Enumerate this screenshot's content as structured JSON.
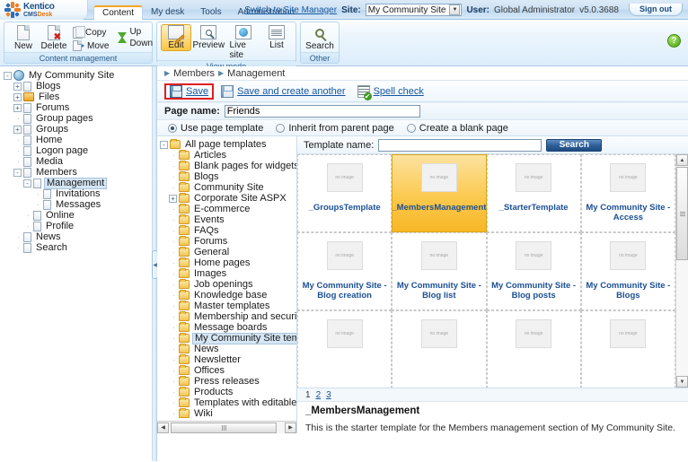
{
  "header": {
    "logo": {
      "brand": "Kentico",
      "cms": "CMS",
      "desk": "Desk"
    },
    "tabs": [
      {
        "label": "Content",
        "active": true
      },
      {
        "label": "My desk",
        "active": false
      },
      {
        "label": "Tools",
        "active": false
      },
      {
        "label": "Administration",
        "active": false
      }
    ],
    "switch_link": "Switch to Site Manager",
    "site_label": "Site:",
    "site_value": "My Community Site",
    "user_label": "User:",
    "user_value": "Global Administrator",
    "version": "v5.0.3688",
    "signout_label": "Sign out",
    "help_icon": "help-icon",
    "accent_orange": "#f5a623",
    "accent_blue": "#1d5b9e"
  },
  "ribbon": {
    "groups": [
      {
        "caption": "Content management",
        "big": [
          {
            "label": "New",
            "icon": "new-page-icon"
          },
          {
            "label": "Delete",
            "icon": "delete-page-icon"
          }
        ],
        "small": [
          {
            "label": "Copy",
            "icon": "copy-icon"
          },
          {
            "label": "Move",
            "icon": "move-icon"
          }
        ],
        "small2": [
          {
            "label": "Up",
            "icon": "arrow-up-icon"
          },
          {
            "label": "Down",
            "icon": "arrow-down-icon"
          }
        ]
      },
      {
        "caption": "View mode",
        "big": [
          {
            "label": "Edit",
            "icon": "edit-icon",
            "selected": true
          },
          {
            "label": "Preview",
            "icon": "preview-icon",
            "selected": false
          },
          {
            "label": "Live site",
            "icon": "live-site-icon",
            "selected": false
          },
          {
            "label": "List",
            "icon": "list-icon",
            "selected": false
          }
        ]
      },
      {
        "caption": "Other",
        "big": [
          {
            "label": "Search",
            "icon": "search-icon"
          }
        ]
      }
    ]
  },
  "content_tree": {
    "nodes": [
      {
        "label": "My Community Site",
        "depth": 0,
        "expander": "-",
        "icon": "globe-icon",
        "selected": false
      },
      {
        "label": "Blogs",
        "depth": 1,
        "expander": "+",
        "icon": "page-icon",
        "selected": false
      },
      {
        "label": "Files",
        "depth": 1,
        "expander": "+",
        "icon": "folder-gold-icon",
        "selected": false
      },
      {
        "label": "Forums",
        "depth": 1,
        "expander": "+",
        "icon": "page-icon",
        "selected": false
      },
      {
        "label": "Group pages",
        "depth": 1,
        "expander": "",
        "icon": "page-icon",
        "selected": false
      },
      {
        "label": "Groups",
        "depth": 1,
        "expander": "+",
        "icon": "page-icon",
        "selected": false
      },
      {
        "label": "Home",
        "depth": 1,
        "expander": "",
        "icon": "page-icon",
        "selected": false
      },
      {
        "label": "Logon page",
        "depth": 1,
        "expander": "",
        "icon": "page-icon",
        "selected": false
      },
      {
        "label": "Media",
        "depth": 1,
        "expander": "",
        "icon": "page-icon",
        "selected": false
      },
      {
        "label": "Members",
        "depth": 1,
        "expander": "-",
        "icon": "page-icon",
        "selected": false
      },
      {
        "label": "Management",
        "depth": 2,
        "expander": "-",
        "icon": "page-icon",
        "selected": true
      },
      {
        "label": "Invitations",
        "depth": 3,
        "expander": "",
        "icon": "page-icon",
        "selected": false
      },
      {
        "label": "Messages",
        "depth": 3,
        "expander": "",
        "icon": "page-icon",
        "selected": false
      },
      {
        "label": "Online",
        "depth": 2,
        "expander": "",
        "icon": "page-icon",
        "selected": false
      },
      {
        "label": "Profile",
        "depth": 2,
        "expander": "",
        "icon": "page-icon",
        "selected": false
      },
      {
        "label": "News",
        "depth": 1,
        "expander": "",
        "icon": "page-icon",
        "selected": false
      },
      {
        "label": "Search",
        "depth": 1,
        "expander": "",
        "icon": "page-icon",
        "selected": false
      }
    ]
  },
  "breadcrumb": {
    "items": [
      "Members",
      "Management"
    ]
  },
  "toolbar": {
    "save_label": "Save",
    "save_create_label": "Save and create another",
    "spell_check_label": "Spell check",
    "highlight_color": "#e02020"
  },
  "form": {
    "page_name_label": "Page name:",
    "page_name_value": "Friends",
    "page_name_placeholder": "",
    "options": [
      {
        "label": "Use page template",
        "selected": true
      },
      {
        "label": "Inherit from parent page",
        "selected": false
      },
      {
        "label": "Create a blank page",
        "selected": false
      }
    ]
  },
  "category_tree": {
    "nodes": [
      {
        "label": "All page templates",
        "depth": 0,
        "expander": "-",
        "selected": false
      },
      {
        "label": "Articles",
        "depth": 1,
        "expander": "",
        "selected": false
      },
      {
        "label": "Blank pages for widgets",
        "depth": 1,
        "expander": "",
        "selected": false
      },
      {
        "label": "Blogs",
        "depth": 1,
        "expander": "",
        "selected": false
      },
      {
        "label": "Community Site",
        "depth": 1,
        "expander": "",
        "selected": false
      },
      {
        "label": "Corporate Site ASPX",
        "depth": 1,
        "expander": "+",
        "selected": false
      },
      {
        "label": "E-commerce",
        "depth": 1,
        "expander": "",
        "selected": false
      },
      {
        "label": "Events",
        "depth": 1,
        "expander": "",
        "selected": false
      },
      {
        "label": "FAQs",
        "depth": 1,
        "expander": "",
        "selected": false
      },
      {
        "label": "Forums",
        "depth": 1,
        "expander": "",
        "selected": false
      },
      {
        "label": "General",
        "depth": 1,
        "expander": "",
        "selected": false
      },
      {
        "label": "Home pages",
        "depth": 1,
        "expander": "",
        "selected": false
      },
      {
        "label": "Images",
        "depth": 1,
        "expander": "",
        "selected": false
      },
      {
        "label": "Job openings",
        "depth": 1,
        "expander": "",
        "selected": false
      },
      {
        "label": "Knowledge base",
        "depth": 1,
        "expander": "",
        "selected": false
      },
      {
        "label": "Master templates",
        "depth": 1,
        "expander": "",
        "selected": false
      },
      {
        "label": "Membership and security",
        "depth": 1,
        "expander": "",
        "selected": false
      },
      {
        "label": "Message boards",
        "depth": 1,
        "expander": "",
        "selected": false
      },
      {
        "label": "My Community Site templates",
        "depth": 1,
        "expander": "",
        "selected": true
      },
      {
        "label": "News",
        "depth": 1,
        "expander": "",
        "selected": false
      },
      {
        "label": "Newsletter",
        "depth": 1,
        "expander": "",
        "selected": false
      },
      {
        "label": "Offices",
        "depth": 1,
        "expander": "",
        "selected": false
      },
      {
        "label": "Press releases",
        "depth": 1,
        "expander": "",
        "selected": false
      },
      {
        "label": "Products",
        "depth": 1,
        "expander": "",
        "selected": false
      },
      {
        "label": "Templates with editable regio",
        "depth": 1,
        "expander": "",
        "selected": false
      },
      {
        "label": "Wiki",
        "depth": 1,
        "expander": "",
        "selected": false
      }
    ]
  },
  "template_search": {
    "label": "Template name:",
    "value": "",
    "placeholder": "",
    "button_label": "Search"
  },
  "templates": {
    "placeholder_text": "no image",
    "items": [
      {
        "name": "_GroupsTemplate",
        "selected": false,
        "wrap": false
      },
      {
        "name": "_MembersManagement",
        "selected": true,
        "wrap": false
      },
      {
        "name": "_StarterTemplate",
        "selected": false,
        "wrap": false
      },
      {
        "name": "My Community Site - Access",
        "selected": false,
        "wrap": true
      },
      {
        "name": "My Community Site - Blog creation",
        "selected": false,
        "wrap": true
      },
      {
        "name": "My Community Site - Blog list",
        "selected": false,
        "wrap": true
      },
      {
        "name": "My Community Site - Blog posts",
        "selected": false,
        "wrap": true
      },
      {
        "name": "My Community Site - Blogs",
        "selected": false,
        "wrap": true
      },
      {
        "name": "",
        "selected": false,
        "wrap": false
      },
      {
        "name": "",
        "selected": false,
        "wrap": false
      },
      {
        "name": "",
        "selected": false,
        "wrap": false
      },
      {
        "name": "",
        "selected": false,
        "wrap": false
      }
    ],
    "selected_color": "#f8b726"
  },
  "pager": {
    "pages": [
      "1",
      "2",
      "3"
    ],
    "current": "1"
  },
  "template_info": {
    "title": "_MembersManagement",
    "description": "This is the starter template for the Members management section of My Community Site."
  }
}
